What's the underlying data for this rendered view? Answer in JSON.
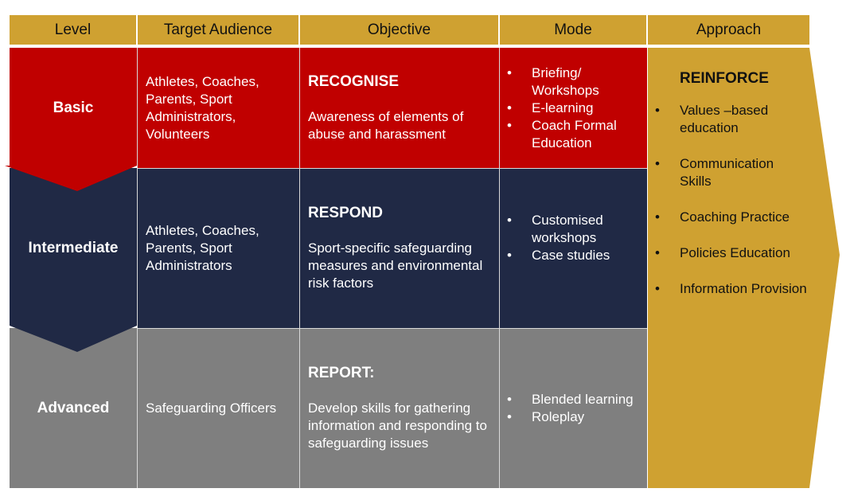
{
  "headers": [
    "Level",
    "Target Audience",
    "Objective",
    "Mode",
    "Approach"
  ],
  "colors": {
    "header": "#CFA131",
    "basic": "#C00000",
    "intermediate": "#202945",
    "advanced": "#7F7F7F",
    "approach": "#CFA131"
  },
  "rows": [
    {
      "level": "Basic",
      "audience": "Athletes, Coaches, Parents, Sport Administrators, Volunteers",
      "objective_title": "RECOGNISE",
      "objective_text": "Awareness of elements of abuse and harassment",
      "mode": [
        "Briefing/ Workshops",
        "E-learning",
        "Coach Formal Education"
      ]
    },
    {
      "level": "Intermediate",
      "audience": "Athletes, Coaches, Parents, Sport Administrators",
      "objective_title": "RESPOND",
      "objective_text": "Sport-specific safeguarding measures and environmental risk factors",
      "mode": [
        "Customised workshops",
        "Case studies"
      ]
    },
    {
      "level": "Advanced",
      "audience": "Safeguarding Officers",
      "objective_title": "REPORT:",
      "objective_text": "Develop skills for gathering information and responding to safeguarding issues",
      "mode": [
        "Blended learning",
        "Roleplay"
      ]
    }
  ],
  "approach": {
    "title": "REINFORCE",
    "items": [
      "Values –based education",
      "Communication Skills",
      "Coaching Practice",
      "Policies Education",
      "Information Provision"
    ]
  }
}
